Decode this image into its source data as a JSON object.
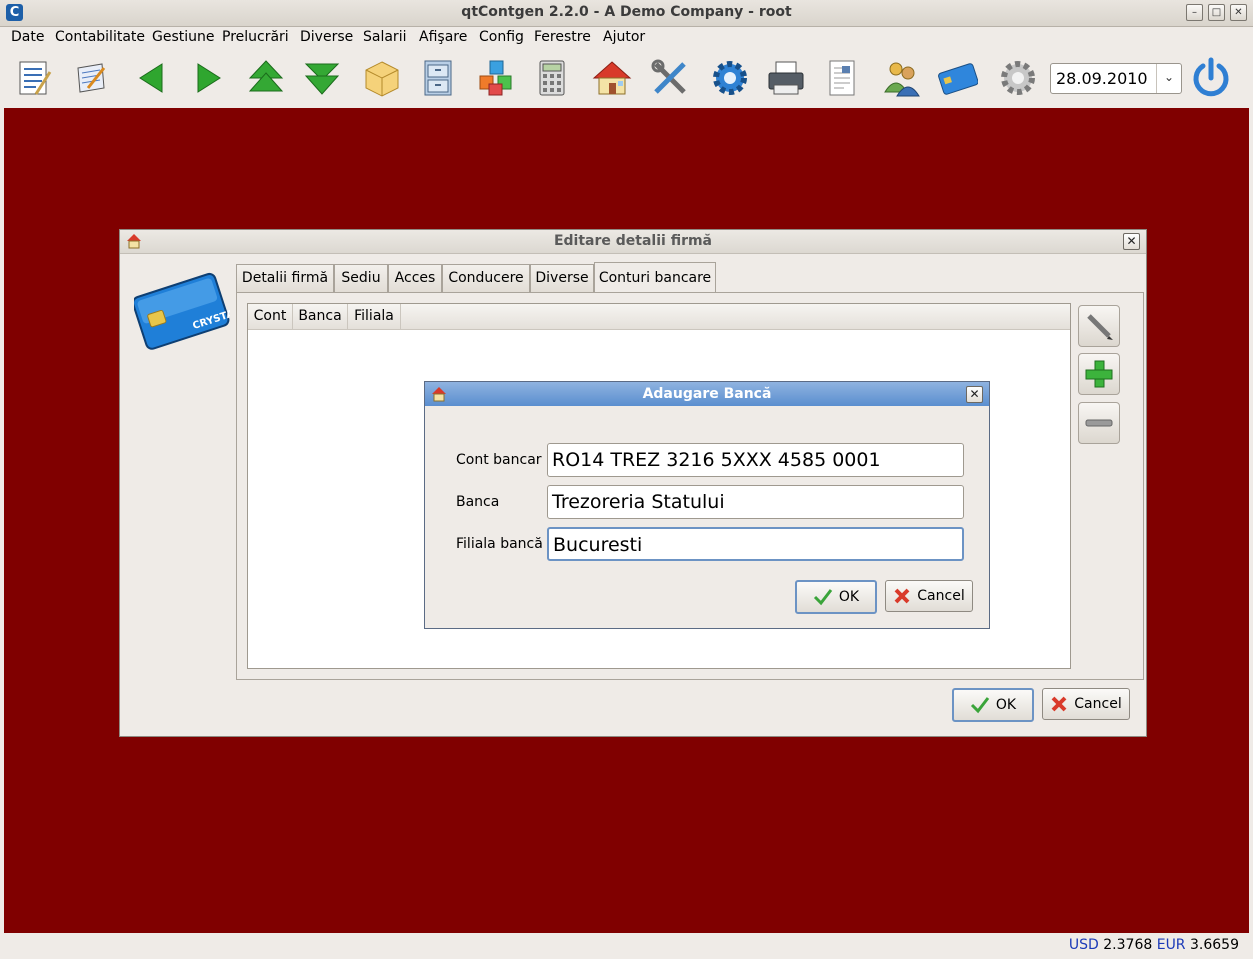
{
  "window": {
    "title": "qtContgen 2.2.0 - A Demo Company - root",
    "app_icon_letter": "C"
  },
  "menu": [
    "Date",
    "Contabilitate",
    "Gestiune",
    "Prelucrări",
    "Diverse",
    "Salarii",
    "Afişare",
    "Config",
    "Ferestre",
    "Ajutor"
  ],
  "toolbar": {
    "icons": [
      "document-list-icon",
      "notepad-icon",
      "arrow-left-icon",
      "arrow-right-icon",
      "arrow-up-icon",
      "arrow-down-icon",
      "package-icon",
      "file-cabinet-icon",
      "cubes-icon",
      "calculator-icon",
      "home-icon",
      "tools-icon",
      "gear-blue-icon",
      "printer-icon",
      "document-icon",
      "users-icon",
      "credit-card-icon",
      "settings-icon"
    ],
    "date": "28.09.2010",
    "power_icon": "power-icon"
  },
  "status": {
    "usd_label": "USD",
    "usd_value": "2.3768",
    "eur_label": "EUR",
    "eur_value": "3.6659"
  },
  "dialog_company": {
    "title": "Editare detalii firmă",
    "card_text": "CRYSTAL",
    "tabs": [
      "Detalii firmă",
      "Sediu",
      "Acces",
      "Conducere",
      "Diverse",
      "Conturi bancare"
    ],
    "active_tab": "Conturi bancare",
    "columns": [
      "Cont",
      "Banca",
      "Filiala"
    ],
    "ok_label": "OK",
    "cancel_label": "Cancel"
  },
  "dialog_bank": {
    "title": "Adaugare Bancă",
    "fields": [
      {
        "label": "Cont bancar",
        "value": "RO14 TREZ 3216 5XXX 4585 0001"
      },
      {
        "label": "Banca",
        "value": "Trezoreria Statului"
      },
      {
        "label": "Filiala bancă",
        "value": "Bucuresti"
      }
    ],
    "ok_label": "OK",
    "cancel_label": "Cancel"
  }
}
